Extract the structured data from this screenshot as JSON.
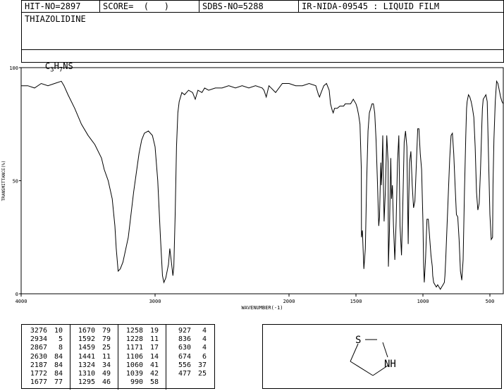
{
  "header": {
    "hit_no": "HIT-NO=2897",
    "score": "SCORE=  (   )",
    "sdbs_no": "SDBS-NO=5288",
    "ir_info": "IR-NIDA-09545 : LIQUID FILM"
  },
  "compound": {
    "name": "THIAZOLIDINE",
    "formula_parts": [
      "C",
      "3",
      "H",
      "7",
      "NS"
    ]
  },
  "chart_data": {
    "type": "line",
    "xlabel": "WAVENUMBER(-1)",
    "ylabel": "TRANSMITTANCE(%)",
    "xlim": [
      4000,
      400
    ],
    "ylim": [
      0,
      100
    ],
    "xticks": [
      4000,
      3000,
      2000,
      1500,
      1000,
      500
    ],
    "xtick_labels": [
      "4000",
      "3000",
      "2000",
      "1500",
      "1000",
      "500"
    ],
    "yticks": [
      0,
      50,
      100
    ],
    "ytick_labels": [
      "0",
      "50",
      "100"
    ],
    "series": [
      {
        "x": [
          4000,
          3950,
          3900,
          3850,
          3800,
          3750,
          3700,
          3680,
          3650,
          3600,
          3550,
          3500,
          3450,
          3400,
          3380,
          3350,
          3320,
          3300,
          3290,
          3276,
          3260,
          3240,
          3200,
          3160,
          3120,
          3100,
          3080,
          3050,
          3020,
          3000,
          2980,
          2960,
          2945,
          2934,
          2920,
          2900,
          2890,
          2880,
          2867,
          2860,
          2850,
          2840,
          2830,
          2820,
          2800,
          2780,
          2750,
          2720,
          2700,
          2680,
          2650,
          2630,
          2600,
          2550,
          2500,
          2450,
          2400,
          2350,
          2300,
          2250,
          2200,
          2187,
          2170,
          2150,
          2100,
          2050,
          2000,
          1950,
          1900,
          1850,
          1800,
          1790,
          1780,
          1772,
          1760,
          1740,
          1720,
          1700,
          1690,
          1677,
          1670,
          1660,
          1640,
          1620,
          1600,
          1592,
          1580,
          1560,
          1540,
          1520,
          1500,
          1490,
          1480,
          1470,
          1460,
          1459,
          1452,
          1441,
          1430,
          1420,
          1410,
          1400,
          1390,
          1380,
          1370,
          1360,
          1350,
          1340,
          1330,
          1324,
          1315,
          1310,
          1305,
          1300,
          1295,
          1290,
          1280,
          1270,
          1260,
          1258,
          1250,
          1240,
          1235,
          1228,
          1220,
          1210,
          1200,
          1190,
          1180,
          1171,
          1160,
          1150,
          1140,
          1130,
          1120,
          1110,
          1106,
          1100,
          1090,
          1080,
          1070,
          1060,
          1050,
          1039,
          1030,
          1020,
          1010,
          1000,
          995,
          990,
          980,
          970,
          960,
          950,
          940,
          930,
          927,
          920,
          910,
          900,
          890,
          880,
          870,
          860,
          850,
          840,
          836,
          830,
          820,
          810,
          800,
          790,
          780,
          770,
          760,
          750,
          740,
          730,
          720,
          710,
          700,
          690,
          680,
          674,
          670,
          660,
          650,
          640,
          630,
          620,
          610,
          600,
          590,
          580,
          570,
          560,
          556,
          550,
          540,
          530,
          520,
          510,
          500,
          490,
          480,
          477,
          470,
          460,
          450,
          440,
          430,
          420,
          410,
          400
        ],
        "y": [
          92,
          92,
          91,
          93,
          92,
          93,
          94,
          92,
          88,
          82,
          75,
          70,
          66,
          60,
          55,
          50,
          42,
          30,
          20,
          10,
          11,
          14,
          25,
          45,
          62,
          68,
          71,
          72,
          70,
          65,
          50,
          25,
          8,
          5,
          7,
          13,
          20,
          15,
          8,
          12,
          35,
          65,
          80,
          85,
          89,
          88,
          90,
          89,
          86,
          90,
          89,
          91,
          90,
          91,
          91,
          92,
          91,
          92,
          91,
          92,
          91,
          90,
          87,
          92,
          89,
          93,
          93,
          92,
          92,
          93,
          92,
          90,
          88,
          87,
          89,
          92,
          93,
          90,
          84,
          81,
          80,
          82,
          82,
          83,
          83,
          83,
          84,
          84,
          84,
          86,
          84,
          82,
          79,
          75,
          55,
          25,
          28,
          11,
          20,
          50,
          72,
          80,
          82,
          84,
          84,
          80,
          68,
          50,
          30,
          34,
          58,
          48,
          56,
          70,
          48,
          32,
          46,
          70,
          58,
          12,
          28,
          60,
          42,
          48,
          30,
          15,
          32,
          58,
          70,
          30,
          17,
          40,
          67,
          72,
          65,
          22,
          41,
          58,
          63,
          48,
          38,
          41,
          56,
          73,
          73,
          62,
          55,
          32,
          12,
          5,
          16,
          33,
          33,
          25,
          17,
          12,
          8,
          5,
          4,
          3,
          4,
          3,
          2,
          3,
          4,
          5,
          8,
          15,
          30,
          45,
          60,
          70,
          71,
          62,
          48,
          35,
          34,
          24,
          10,
          6,
          15,
          45,
          70,
          82,
          85,
          88,
          87,
          85,
          82,
          78,
          65,
          45,
          37,
          40,
          55,
          75,
          82,
          86,
          87,
          88,
          85,
          60,
          35,
          24,
          25,
          48,
          68,
          85,
          94,
          93,
          90,
          87,
          85,
          84
        ]
      }
    ]
  },
  "peak_table": [
    [
      [
        "3276",
        "10"
      ],
      [
        "2934",
        "5"
      ],
      [
        "2867",
        "8"
      ],
      [
        "2630",
        "84"
      ],
      [
        "2187",
        "84"
      ],
      [
        "1772",
        "84"
      ],
      [
        "1677",
        "77"
      ]
    ],
    [
      [
        "1670",
        "79"
      ],
      [
        "1592",
        "79"
      ],
      [
        "1459",
        "25"
      ],
      [
        "1441",
        "11"
      ],
      [
        "1324",
        "34"
      ],
      [
        "1310",
        "49"
      ],
      [
        "1295",
        "46"
      ]
    ],
    [
      [
        "1258",
        "19"
      ],
      [
        "1228",
        "11"
      ],
      [
        "1171",
        "17"
      ],
      [
        "1106",
        "14"
      ],
      [
        "1060",
        "41"
      ],
      [
        "1039",
        "42"
      ],
      [
        "990",
        "58"
      ]
    ],
    [
      [
        "927",
        "4"
      ],
      [
        "836",
        "4"
      ],
      [
        "630",
        "4"
      ],
      [
        "674",
        "6"
      ],
      [
        "556",
        "37"
      ],
      [
        "477",
        "25"
      ]
    ]
  ],
  "structure": {
    "atom_s": "S",
    "atom_nh": "NH"
  }
}
